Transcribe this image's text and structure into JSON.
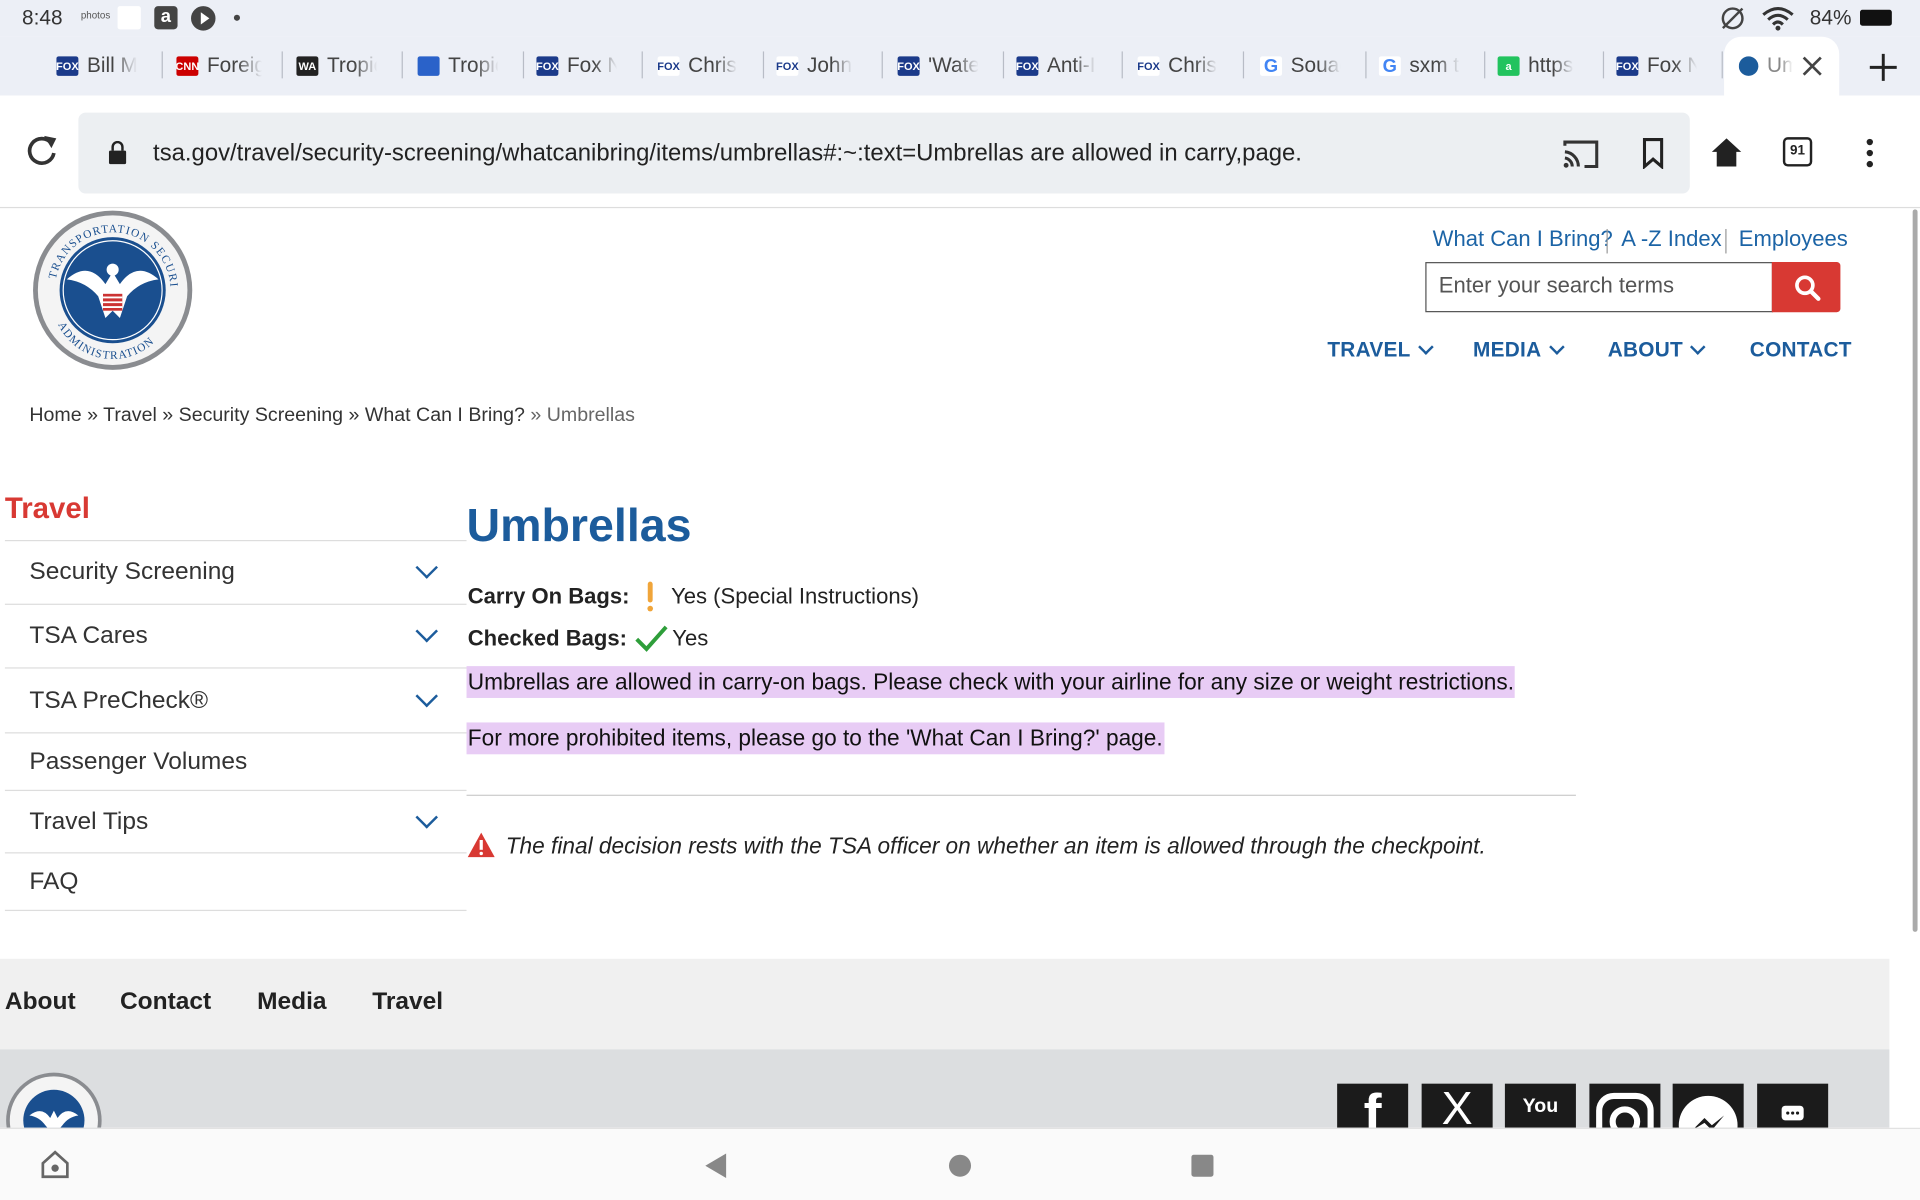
{
  "status_bar": {
    "time": "8:48",
    "battery": "84%",
    "notif_photos": "photos"
  },
  "tabs": [
    {
      "label": "Bill M",
      "fav": "FOX",
      "color": "#1b3a8a"
    },
    {
      "label": "Foreign",
      "fav": "CNN",
      "color": "#cc0000"
    },
    {
      "label": "Tropical",
      "fav": "WA",
      "color": "#222222"
    },
    {
      "label": "Tropical",
      "fav": "",
      "color": "#2a62c9"
    },
    {
      "label": "Fox N",
      "fav": "FOX",
      "color": "#1b3a8a"
    },
    {
      "label": "Chris",
      "fav": "FOX",
      "color": "#ffffff"
    },
    {
      "label": "John",
      "fav": "FOX",
      "color": "#ffffff"
    },
    {
      "label": "'Water",
      "fav": "FOX",
      "color": "#1b3a8a"
    },
    {
      "label": "Anti-I",
      "fav": "FOX",
      "color": "#1b3a8a"
    },
    {
      "label": "Chris",
      "fav": "FOX",
      "color": "#ffffff"
    },
    {
      "label": "Souad",
      "fav": "G",
      "color": "#ffffff"
    },
    {
      "label": "sxm t",
      "fav": "G",
      "color": "#ffffff"
    },
    {
      "label": "https",
      "fav": "a",
      "color": "#22c35e"
    },
    {
      "label": "Fox N",
      "fav": "FOX",
      "color": "#1b3a8a"
    },
    {
      "label": "Um",
      "fav": "",
      "color": "#1c5c9c"
    }
  ],
  "address": {
    "url": "tsa.gov/travel/security-screening/whatcanibring/items/umbrellas#:~:text=Umbrellas are allowed in carry,page.",
    "tab_count": "91"
  },
  "header": {
    "links": [
      "What Can I Bring?",
      "A -Z Index",
      "Employees"
    ],
    "search_placeholder": "Enter your search terms",
    "nav": [
      "TRAVEL",
      "MEDIA",
      "ABOUT",
      "CONTACT"
    ],
    "logo_text": "TRANSPORTATION SECURITY ADMINISTRATION"
  },
  "breadcrumb": {
    "home": "Home",
    "travel": "Travel",
    "screening": "Security Screening",
    "wcib": "What Can I Bring?",
    "current": "Umbrellas",
    "sep": "»"
  },
  "sidebar": {
    "title": "Travel",
    "items": [
      {
        "label": "Security Screening",
        "expandable": true
      },
      {
        "label": "TSA Cares",
        "expandable": true
      },
      {
        "label": "TSA PreCheck®",
        "expandable": true
      },
      {
        "label": "Passenger Volumes",
        "expandable": false
      },
      {
        "label": "Travel Tips",
        "expandable": true
      },
      {
        "label": "FAQ",
        "expandable": false
      }
    ]
  },
  "main": {
    "title": "Umbrellas",
    "carry_label": "Carry On Bags:",
    "carry_value": "Yes (Special Instructions)",
    "checked_label": "Checked Bags:",
    "checked_value": "Yes",
    "para1": "Umbrellas are allowed in carry-on bags. Please check with your airline for any size or weight restrictions.",
    "para2": "For more prohibited items, please go to the 'What Can I Bring?' page.",
    "notice": "The final decision rests with the TSA officer on whether an item is allowed through the checkpoint."
  },
  "footer": {
    "links": [
      "About",
      "Contact",
      "Media",
      "Travel"
    ],
    "social": [
      "facebook-icon",
      "x-icon",
      "youtube-icon",
      "instagram-icon",
      "messenger-icon",
      "sms-icon"
    ]
  },
  "colors": {
    "tsa_blue": "#1c5c9c",
    "tsa_red": "#d83933",
    "highlight": "#e8ccf5",
    "chrome_bg": "#eceff6"
  }
}
